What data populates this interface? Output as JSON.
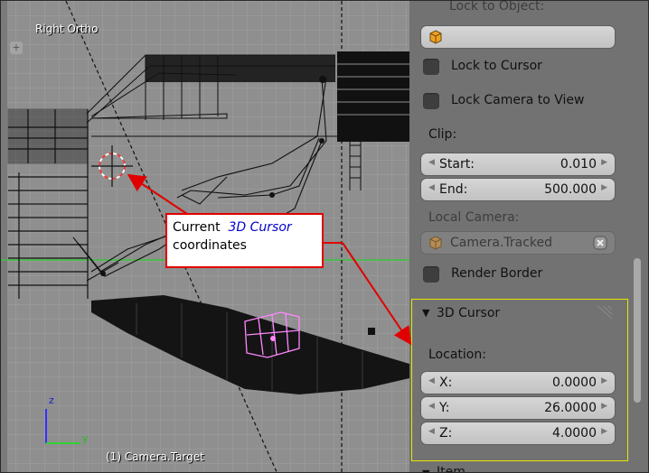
{
  "viewport": {
    "title": "Right Ortho",
    "footer": "(1) Camera.Target",
    "axes": {
      "z": "z",
      "y": "y"
    }
  },
  "panel": {
    "lock_to_object_label": "Lock to Object:",
    "lock_to_cursor": "Lock to Cursor",
    "lock_camera_to_view": "Lock Camera to View",
    "clip": {
      "label": "Clip:",
      "start_label": "Start:",
      "start_value": "0.010",
      "end_label": "End:",
      "end_value": "500.000"
    },
    "local_camera": {
      "label": "Local Camera:",
      "value": "Camera.Tracked"
    },
    "render_border": "Render Border",
    "cursor_section": {
      "title": "3D Cursor",
      "location_label": "Location:",
      "x_label": "X:",
      "x_value": "0.0000",
      "y_label": "Y:",
      "y_value": "26.0000",
      "z_label": "Z:",
      "z_value": "4.0000"
    },
    "next_section_title": "Item"
  },
  "annotation": {
    "text_before": "Current",
    "highlight": "3D Cursor",
    "text_after": "coordinates"
  },
  "colors": {
    "annotation_border": "#e00000",
    "highlight_text": "#0000cc",
    "cursor_panel_outline": "#e6e600"
  }
}
